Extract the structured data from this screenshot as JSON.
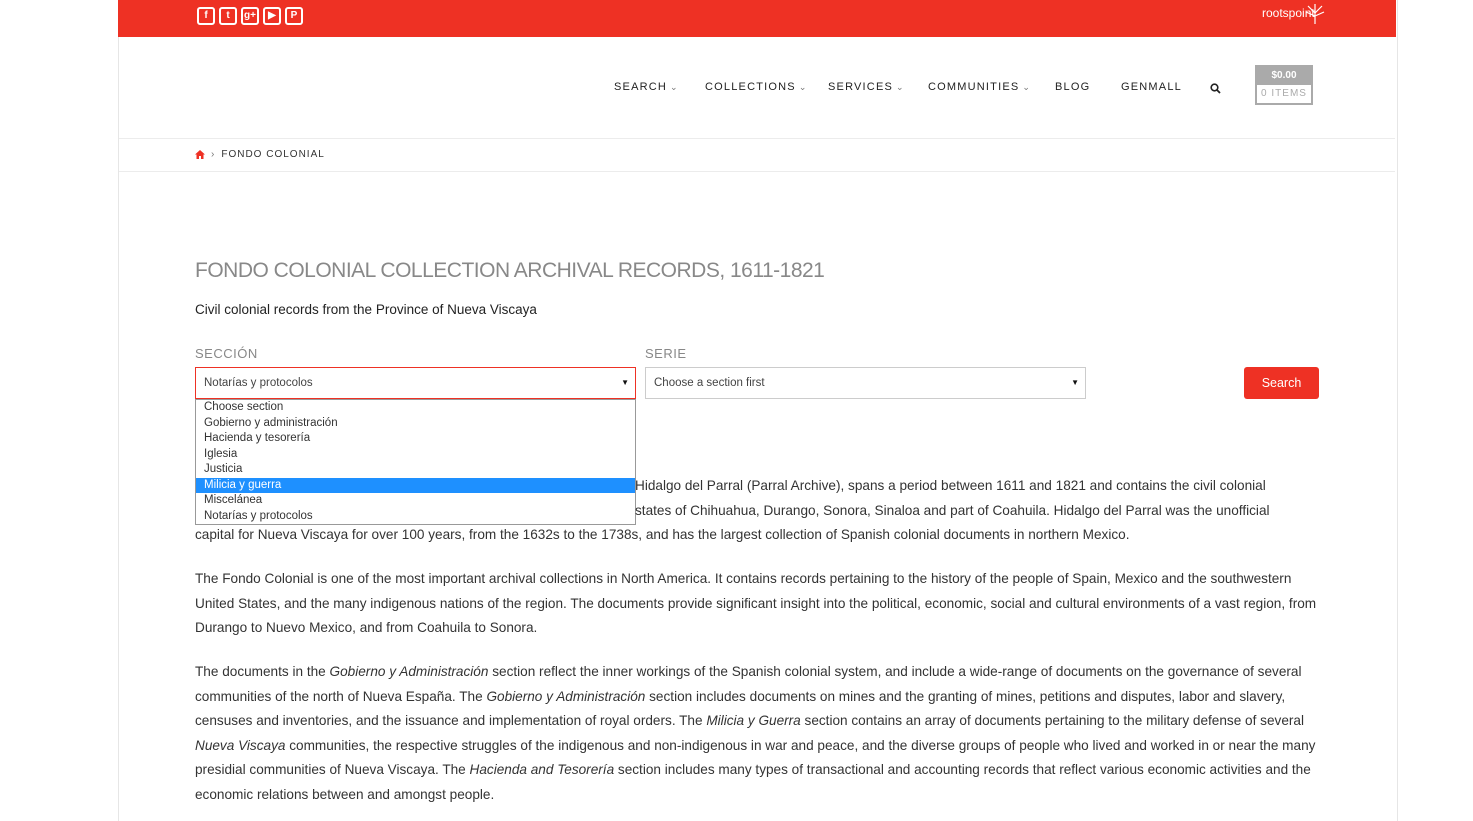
{
  "social": [
    "f",
    "t",
    "g+",
    "▶",
    "P"
  ],
  "brand": "rootspoint",
  "nav": {
    "search": "SEARCH",
    "collections": "COLLECTIONS",
    "services": "SERVICES",
    "communities": "COMMUNITIES",
    "blog": "BLOG",
    "genmall": "GENMALL"
  },
  "cart": {
    "amount": "$0.00",
    "items": "0 ITEMS"
  },
  "breadcrumb": {
    "current": "FONDO COLONIAL"
  },
  "page": {
    "title": "FONDO COLONIAL COLLECTION ARCHIVAL RECORDS, 1611-1821",
    "subtitle": "Civil colonial records from the Province of Nueva Viscaya"
  },
  "form": {
    "seccion_label": "SECCIÓN",
    "serie_label": "SERIE",
    "seccion_value": "Notarías y protocolos",
    "serie_value": "Choose a section first",
    "search_button": "Search",
    "options": [
      "Choose section",
      "Gobierno y administración",
      "Hacienda y tesorería",
      "Iglesia",
      "Justicia",
      "Milicia y guerra",
      "Miscelánea",
      "Notarías y protocolos"
    ],
    "highlighted_option": "Milicia y guerra"
  },
  "content": {
    "p1_l1": "Hidalgo del Parral (Parral Archive), spans a period between 1611 and 1821 and contains the civil colonial",
    "p1_l2": "states of Chihuahua, Durango, Sonora, Sinaloa and part of Coahuila. Hidalgo del Parral was the unofficial",
    "p1_l3": "capital for Nueva Viscaya for over 100 years, from the 1632s to the 1738s, and has the largest collection of Spanish colonial documents in northern Mexico.",
    "p2": "The Fondo Colonial is one of the most important archival collections in North America. It contains records pertaining to the history of the people of Spain, Mexico and the southwestern United States, and the many indigenous nations of the region. The documents provide significant insight into the political, economic, social and cultural environments of a vast region, from Durango to Nuevo Mexico, and from Coahuila to Sonora.",
    "p3_a": "The documents in the ",
    "p3_b": "Gobierno y Administración",
    "p3_c": " section reflect the inner workings of the Spanish colonial system, and include a wide-range of documents on the governance of several communities of the north of Nueva España. The ",
    "p3_d": "Gobierno y Administración",
    "p3_e": " section includes documents on mines and the granting of mines, petitions and disputes, labor and slavery, censuses and inventories, and the issuance and implementation of royal orders. The ",
    "p3_f": "Milicia y Guerra",
    "p3_g": " section contains an array of documents pertaining to the military defense of several ",
    "p3_h": "Nueva Viscaya",
    "p3_i": " communities, the respective struggles of the indigenous and non-indigenous in war and peace, and the diverse groups of people who lived and worked in or near the many presidial communities of Nueva Viscaya. The ",
    "p3_j": "Hacienda and Tesorería",
    "p3_k": " section includes many types of transactional and accounting records that reflect various economic activities and the economic relations between and amongst people."
  }
}
